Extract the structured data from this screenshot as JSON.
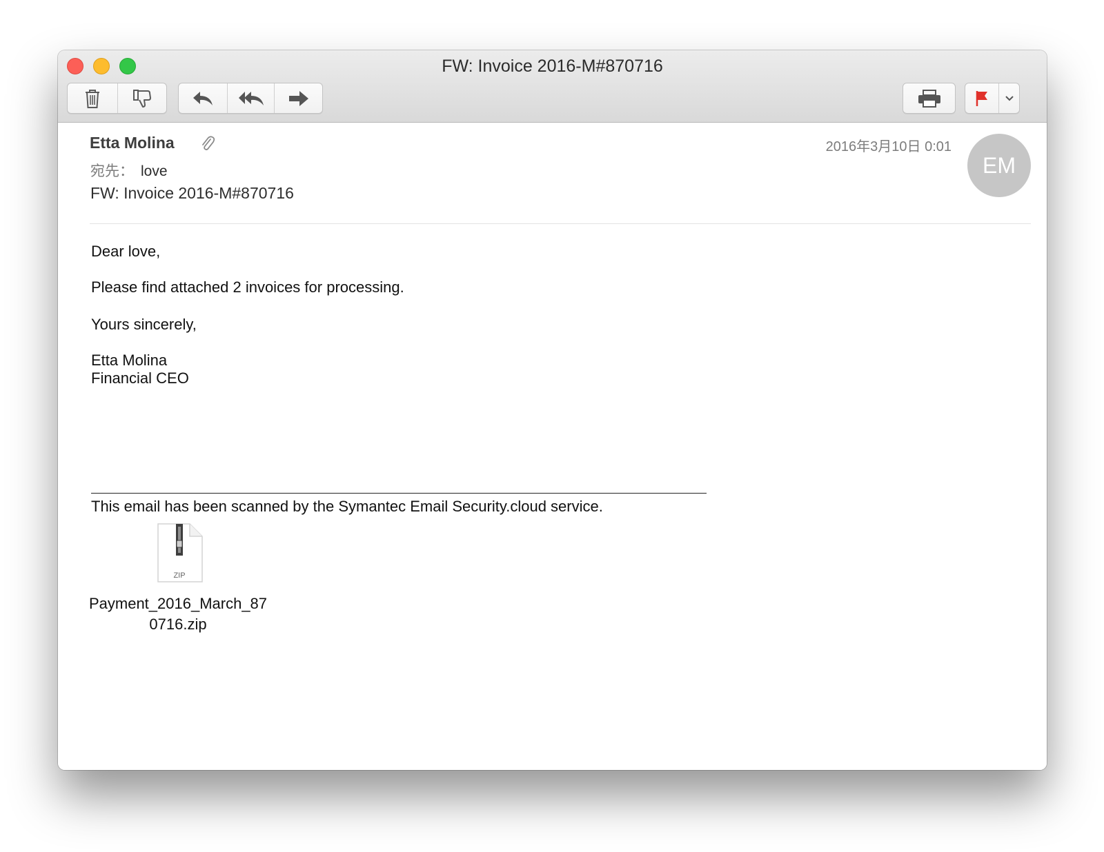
{
  "window": {
    "title": "FW: Invoice 2016-M#870716"
  },
  "toolbar": {
    "buttons": [
      {
        "icon": "trash-icon",
        "label": "Delete"
      },
      {
        "icon": "junk-icon",
        "label": "Junk"
      },
      {
        "icon": "reply-icon",
        "label": "Reply"
      },
      {
        "icon": "reply-all-icon",
        "label": "Reply All"
      },
      {
        "icon": "forward-icon",
        "label": "Forward"
      },
      {
        "icon": "printer-icon",
        "label": "Print"
      },
      {
        "icon": "flag-icon",
        "label": "Flag"
      },
      {
        "icon": "chevron-down-icon",
        "label": "Flag options"
      }
    ],
    "flag_color": "#e0312b"
  },
  "message": {
    "sender": "Etta Molina",
    "to_label": "宛先：",
    "to_value": "love",
    "subject": "FW: Invoice 2016-M#870716",
    "date": "2016年3月10日 0:01",
    "avatar_initials": "EM",
    "body": {
      "greeting": "Dear  love,",
      "line1": "Please find attached 2 invoices for processing.",
      "closing": "Yours sincerely,",
      "signature_name": "Etta Molina",
      "signature_title": "Financial CEO",
      "disclaimer": "This email has been scanned by the Symantec Email Security.cloud service."
    },
    "attachment": {
      "type_label": "ZIP",
      "filename": "Payment_2016_March_870716.zip"
    }
  }
}
